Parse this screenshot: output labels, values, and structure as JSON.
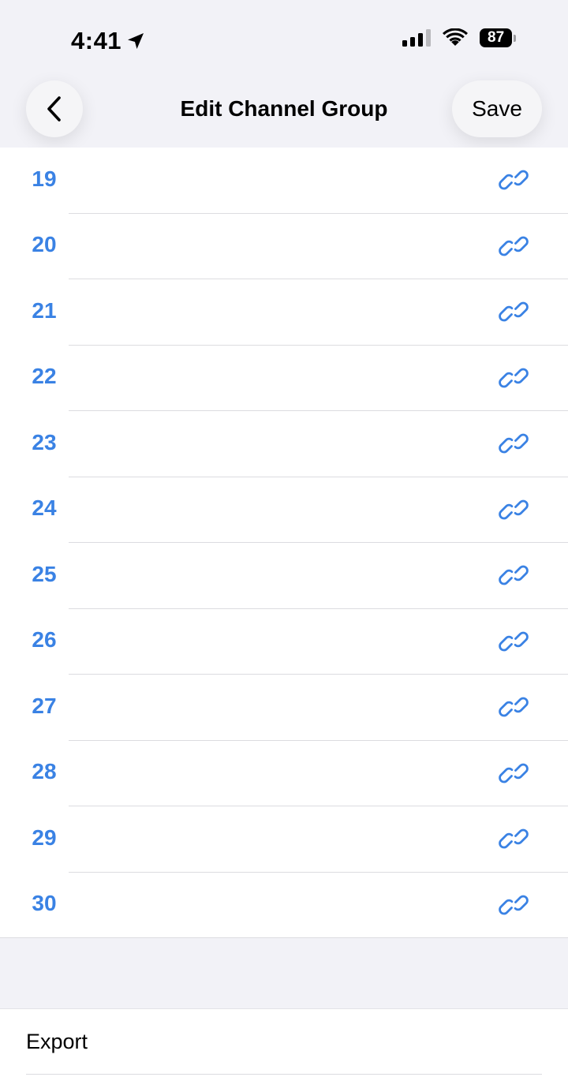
{
  "status_bar": {
    "time": "4:41",
    "battery": "87"
  },
  "nav": {
    "title": "Edit Channel Group",
    "save_label": "Save"
  },
  "colors": {
    "accent": "#3a82e4",
    "background": "#f2f2f7"
  },
  "channels": [
    {
      "number": "19",
      "icon": "link-icon"
    },
    {
      "number": "20",
      "icon": "link-icon"
    },
    {
      "number": "21",
      "icon": "link-icon"
    },
    {
      "number": "22",
      "icon": "link-icon"
    },
    {
      "number": "23",
      "icon": "link-icon"
    },
    {
      "number": "24",
      "icon": "link-icon"
    },
    {
      "number": "25",
      "icon": "link-icon"
    },
    {
      "number": "26",
      "icon": "link-icon"
    },
    {
      "number": "27",
      "icon": "link-icon"
    },
    {
      "number": "28",
      "icon": "link-icon"
    },
    {
      "number": "29",
      "icon": "link-icon"
    },
    {
      "number": "30",
      "icon": "link-icon"
    }
  ],
  "export": {
    "label": "Export"
  }
}
